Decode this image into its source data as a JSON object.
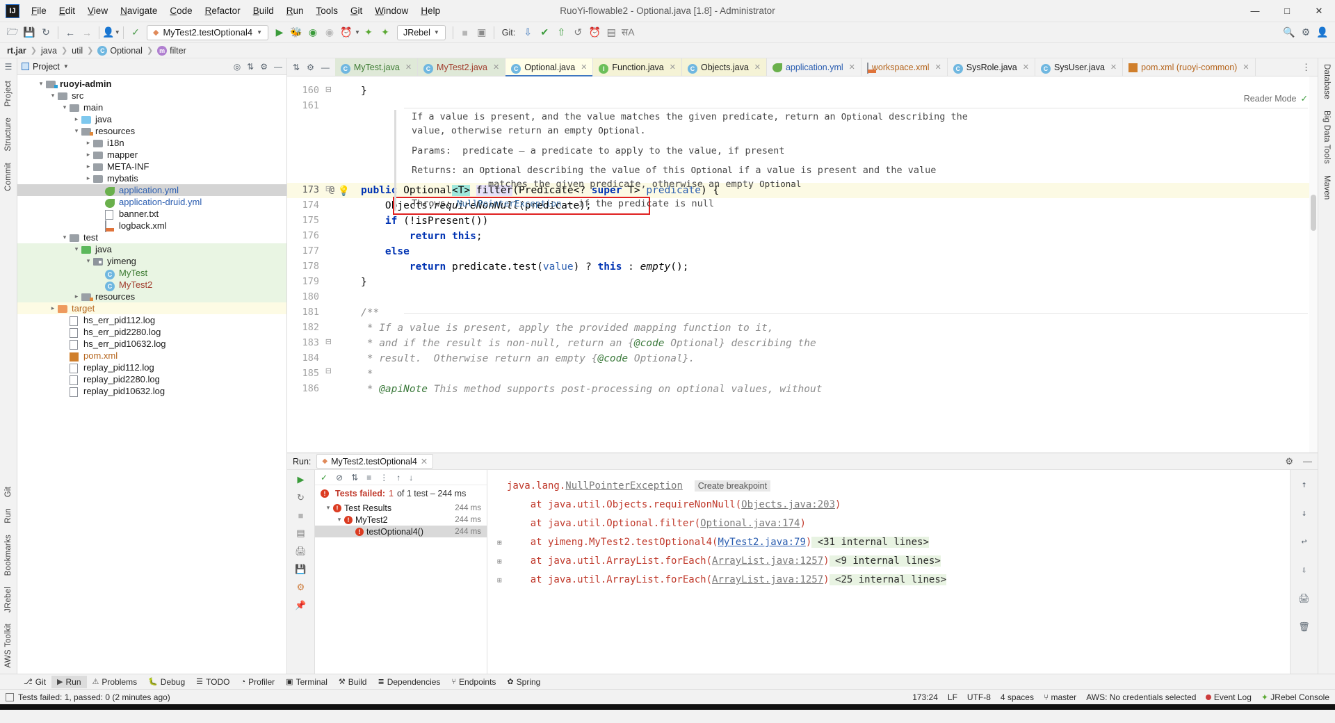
{
  "window": {
    "title": "RuoYi-flowable2 - Optional.java [1.8] - Administrator",
    "logo": "IJ",
    "minimize": "—",
    "maximize": "□",
    "close": "✕"
  },
  "menu": [
    "File",
    "Edit",
    "View",
    "Navigate",
    "Code",
    "Refactor",
    "Build",
    "Run",
    "Tools",
    "Git",
    "Window",
    "Help"
  ],
  "toolbar": {
    "run_config": "MyTest2.testOptional4",
    "git_label": "Git:",
    "icons": [
      "open-folder-icon",
      "save-icon",
      "sync-icon",
      "back-arrow-icon",
      "forward-arrow-icon",
      "profile-icon",
      "build-hammer-icon"
    ],
    "run_icons": [
      "run-icon",
      "debug-icon",
      "run-coverage-icon",
      "profile-run-icon",
      "run-dashboard-icon",
      "jrebel-run-icon",
      "jrebel-debug-icon"
    ],
    "jrebel_label": "JRebel",
    "git_icons": [
      "update-project-icon",
      "commit-icon",
      "check-icon",
      "push-icon",
      "history-icon",
      "rollback-icon"
    ],
    "right_icons": [
      "search-icon",
      "settings-gear-icon",
      "account-icon"
    ]
  },
  "breadcrumb": [
    {
      "label": "rt.jar",
      "bold": true
    },
    {
      "label": "java"
    },
    {
      "label": "util"
    },
    {
      "label": "Optional",
      "icon": "class-icon"
    },
    {
      "label": "filter",
      "icon": "method-icon"
    }
  ],
  "left_strip": [
    "Project",
    "Structure",
    "Commit"
  ],
  "left_strip_bottom": [
    "Git",
    "Run",
    "Bookmarks",
    "JRebel",
    "AWS Toolkit"
  ],
  "right_strip": [
    "Database",
    "Big Data Tools",
    "Maven"
  ],
  "project": {
    "header": "Project",
    "tree": [
      {
        "indent": 1,
        "arrow": "v",
        "label": "ruoyi-admin",
        "icon": "module-folder-icon",
        "style": "bold"
      },
      {
        "indent": 2,
        "arrow": "v",
        "label": "src",
        "icon": "folder-icon"
      },
      {
        "indent": 3,
        "arrow": "v",
        "label": "main",
        "icon": "folder-icon"
      },
      {
        "indent": 4,
        "arrow": ">",
        "label": "java",
        "icon": "source-folder-icon"
      },
      {
        "indent": 4,
        "arrow": "v",
        "label": "resources",
        "icon": "resources-folder-icon"
      },
      {
        "indent": 5,
        "arrow": ">",
        "label": "i18n",
        "icon": "folder-icon"
      },
      {
        "indent": 5,
        "arrow": ">",
        "label": "mapper",
        "icon": "folder-icon"
      },
      {
        "indent": 5,
        "arrow": ">",
        "label": "META-INF",
        "icon": "folder-icon"
      },
      {
        "indent": 5,
        "arrow": ">",
        "label": "mybatis",
        "icon": "folder-icon"
      },
      {
        "indent": 6,
        "arrow": "",
        "label": "application.yml",
        "icon": "yml-icon",
        "selected": true,
        "color": "blue"
      },
      {
        "indent": 6,
        "arrow": "",
        "label": "application-druid.yml",
        "icon": "yml-icon",
        "color": "blue"
      },
      {
        "indent": 6,
        "arrow": "",
        "label": "banner.txt",
        "icon": "text-file-icon"
      },
      {
        "indent": 6,
        "arrow": "",
        "label": "logback.xml",
        "icon": "xml-file-icon"
      },
      {
        "indent": 3,
        "arrow": "v",
        "label": "test",
        "icon": "folder-icon"
      },
      {
        "indent": 4,
        "arrow": "v",
        "label": "java",
        "icon": "test-source-folder-icon",
        "bg": "green"
      },
      {
        "indent": 5,
        "arrow": "v",
        "label": "yimeng",
        "icon": "package-icon",
        "bg": "green"
      },
      {
        "indent": 6,
        "arrow": "",
        "label": "MyTest",
        "icon": "test-class-icon",
        "bg": "green",
        "color": "green"
      },
      {
        "indent": 6,
        "arrow": "",
        "label": "MyTest2",
        "icon": "test-class-icon",
        "bg": "green",
        "color": "red"
      },
      {
        "indent": 4,
        "arrow": ">",
        "label": "resources",
        "icon": "test-resources-folder-icon",
        "bg": "green"
      },
      {
        "indent": 2,
        "arrow": ">",
        "label": "target",
        "icon": "target-folder-icon",
        "bg": "yellow",
        "color": "orange"
      },
      {
        "indent": 3,
        "arrow": "",
        "label": "hs_err_pid112.log",
        "icon": "log-file-icon"
      },
      {
        "indent": 3,
        "arrow": "",
        "label": "hs_err_pid2280.log",
        "icon": "log-file-icon"
      },
      {
        "indent": 3,
        "arrow": "",
        "label": "hs_err_pid10632.log",
        "icon": "log-file-icon"
      },
      {
        "indent": 3,
        "arrow": "",
        "label": "pom.xml",
        "icon": "maven-icon",
        "color": "orange"
      },
      {
        "indent": 3,
        "arrow": "",
        "label": "replay_pid112.log",
        "icon": "log-file-icon"
      },
      {
        "indent": 3,
        "arrow": "",
        "label": "replay_pid2280.log",
        "icon": "log-file-icon"
      },
      {
        "indent": 3,
        "arrow": "",
        "label": "replay_pid10632.log",
        "icon": "log-file-icon"
      }
    ]
  },
  "editor": {
    "tabs": [
      {
        "label": "MyTest.java",
        "icon": "test-class-icon",
        "theme": "green",
        "color": "green"
      },
      {
        "label": "MyTest2.java",
        "icon": "test-class-icon",
        "theme": "green",
        "color": "red"
      },
      {
        "label": "Optional.java",
        "icon": "class-icon",
        "theme": "active"
      },
      {
        "label": "Function.java",
        "icon": "interface-icon",
        "theme": "yellow"
      },
      {
        "label": "Objects.java",
        "icon": "class-icon",
        "theme": "yellow"
      },
      {
        "label": "application.yml",
        "icon": "yml-icon",
        "theme": "white",
        "color": "blue"
      },
      {
        "label": "workspace.xml",
        "icon": "xml-file-icon",
        "theme": "white",
        "color": "orange"
      },
      {
        "label": "SysRole.java",
        "icon": "class-icon",
        "theme": "white"
      },
      {
        "label": "SysUser.java",
        "icon": "class-icon",
        "theme": "white"
      },
      {
        "label": "pom.xml (ruoyi-common)",
        "icon": "maven-icon",
        "theme": "white",
        "color": "orange"
      }
    ],
    "reader_mode": "Reader Mode",
    "doc": {
      "line1_a": "If a value is present, and the value matches the given predicate, return an ",
      "line1_b": "Optional",
      "line1_c": " describing the",
      "line2_a": "value, otherwise return an empty ",
      "line2_b": "Optional",
      "line2_c": ".",
      "params_label": "Params:",
      "params_text": "predicate – a predicate to apply to the value, if present",
      "returns_label": "Returns:",
      "returns_a": "an ",
      "returns_b": "Optional",
      "returns_c": " describing the value of this ",
      "returns_d": "Optional",
      "returns_e": " if a value is present and the value",
      "returns_f": "matches the given predicate, otherwise an empty ",
      "returns_g": "Optional",
      "throws_label": "Throws:",
      "throws_link": "NullPointerException",
      "throws_text": " – if the predicate is null"
    },
    "lines": [
      {
        "num": "160",
        "text": "}"
      },
      {
        "num": "161",
        "text": ""
      },
      {
        "num": "173",
        "text": "public Optional<T> filter(Predicate<? super T> predicate) {",
        "current": true,
        "annot": "@",
        "bulb": true
      },
      {
        "num": "174",
        "text": "Objects.requireNonNull(predicate);",
        "highlighted": true
      },
      {
        "num": "175",
        "text": "if (!isPresent())"
      },
      {
        "num": "176",
        "text": "return this;"
      },
      {
        "num": "177",
        "text": "else"
      },
      {
        "num": "178",
        "text": "return predicate.test(value) ? this : empty();"
      },
      {
        "num": "179",
        "text": "}"
      },
      {
        "num": "180",
        "text": ""
      },
      {
        "num": "181",
        "text": "/**"
      },
      {
        "num": "182",
        "text": " * If a value is present, apply the provided mapping function to it,"
      },
      {
        "num": "183",
        "text": " * and if the result is non-null, return an {@code Optional} describing the"
      },
      {
        "num": "184",
        "text": " * result.  Otherwise return an empty {@code Optional}."
      },
      {
        "num": "185",
        "text": " *"
      },
      {
        "num": "186",
        "text": " * @apiNote This method supports post-processing on optional values, without"
      }
    ]
  },
  "run": {
    "label": "Run:",
    "tab": "MyTest2.testOptional4",
    "status_prefix": "Tests failed:",
    "status_count": "1",
    "status_suffix": "of 1 test – 244 ms",
    "tree": [
      {
        "indent": 0,
        "arrow": "v",
        "label": "Test Results",
        "ms": "244 ms",
        "error": true
      },
      {
        "indent": 1,
        "arrow": "v",
        "label": "MyTest2",
        "ms": "244 ms",
        "error": true
      },
      {
        "indent": 2,
        "arrow": "",
        "label": "testOptional4()",
        "ms": "244 ms",
        "error": true,
        "selected": true
      }
    ],
    "console": [
      {
        "parts": [
          {
            "t": "java.lang.",
            "c": "err"
          },
          {
            "t": "NullPointerException",
            "c": "link"
          },
          {
            "t": "  ",
            "c": "plain"
          },
          {
            "t": "Create breakpoint",
            "c": "bp"
          }
        ]
      },
      {
        "parts": [
          {
            "t": "    at java.util.Objects.requireNonNull(",
            "c": "err"
          },
          {
            "t": "Objects.java:203",
            "c": "link"
          },
          {
            "t": ")",
            "c": "err"
          }
        ]
      },
      {
        "parts": [
          {
            "t": "    at java.util.Optional.filter(",
            "c": "err"
          },
          {
            "t": "Optional.java:174",
            "c": "link"
          },
          {
            "t": ")",
            "c": "err"
          }
        ]
      },
      {
        "expand": true,
        "parts": [
          {
            "t": "    at yimeng.MyTest2.testOptional4(",
            "c": "err"
          },
          {
            "t": "MyTest2.java:79",
            "c": "linkb"
          },
          {
            "t": ")",
            "c": "err"
          },
          {
            "t": " <31 internal lines>",
            "c": "int"
          }
        ]
      },
      {
        "expand": true,
        "parts": [
          {
            "t": "    at java.util.ArrayList.forEach(",
            "c": "err"
          },
          {
            "t": "ArrayList.java:1257",
            "c": "link"
          },
          {
            "t": ")",
            "c": "err"
          },
          {
            "t": " <9 internal lines>",
            "c": "int"
          }
        ]
      },
      {
        "expand": true,
        "parts": [
          {
            "t": "    at java.util.ArrayList.forEach(",
            "c": "err"
          },
          {
            "t": "ArrayList.java:1257",
            "c": "link"
          },
          {
            "t": ")",
            "c": "err"
          },
          {
            "t": " <25 internal lines>",
            "c": "int"
          }
        ]
      }
    ]
  },
  "toolwindows": [
    {
      "label": "Git",
      "icon": "git-branch-icon"
    },
    {
      "label": "Run",
      "icon": "run-icon",
      "active": true
    },
    {
      "label": "Problems",
      "icon": "problems-icon"
    },
    {
      "label": "Debug",
      "icon": "debug-icon"
    },
    {
      "label": "TODO",
      "icon": "todo-icon"
    },
    {
      "label": "Profiler",
      "icon": "profiler-icon"
    },
    {
      "label": "Terminal",
      "icon": "terminal-icon"
    },
    {
      "label": "Build",
      "icon": "build-icon"
    },
    {
      "label": "Dependencies",
      "icon": "dependencies-icon"
    },
    {
      "label": "Endpoints",
      "icon": "endpoints-icon"
    },
    {
      "label": "Spring",
      "icon": "spring-icon"
    }
  ],
  "status": {
    "message": "Tests failed: 1, passed: 0 (2 minutes ago)",
    "caret": "173:24",
    "line_sep": "LF",
    "encoding": "UTF-8",
    "indent": "4 spaces",
    "branch": "master",
    "aws": "AWS: No credentials selected",
    "event_log": "Event Log",
    "jrebel_console": "JRebel Console"
  },
  "colors": {
    "accent": "#3f77c0",
    "error": "#db3b21",
    "keyword": "#0033b3",
    "highlight_box": "#e02020",
    "green_bg": "#e9f5e3",
    "yellow_bg": "#fdfbe4"
  }
}
